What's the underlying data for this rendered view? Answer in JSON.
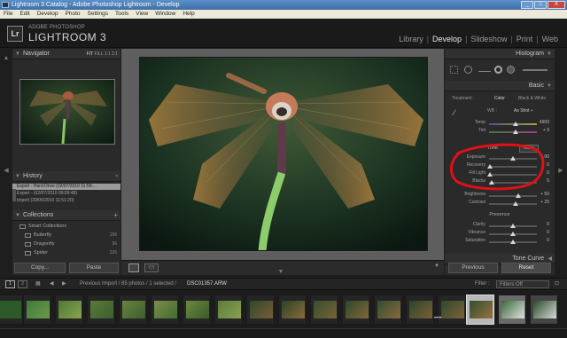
{
  "window": {
    "title": "Lightroom 3 Catalog - Adobe Photoshop Lightroom - Develop",
    "buttons": [
      "_",
      "□",
      "X"
    ]
  },
  "menu": [
    "File",
    "Edit",
    "Develop",
    "Photo",
    "Settings",
    "Tools",
    "View",
    "Window",
    "Help"
  ],
  "identity": {
    "logo": "Lr",
    "product_small": "ADOBE PHOTOSHOP",
    "product_big": "LIGHTROOM 3"
  },
  "modules": [
    {
      "label": "Library",
      "active": false
    },
    {
      "label": "Develop",
      "active": true
    },
    {
      "label": "Slideshow",
      "active": false
    },
    {
      "label": "Print",
      "active": false
    },
    {
      "label": "Web",
      "active": false
    }
  ],
  "navigator": {
    "title": "Navigator",
    "zoom_options": [
      "FIT",
      "FILL",
      "1:1",
      "3:1"
    ]
  },
  "history": {
    "title": "History",
    "items": [
      {
        "label": "Export - Hard Drive (02/07/2010 11:59:...",
        "selected": true
      },
      {
        "label": "Export - (02/07/2010 09:09:48)",
        "selected": false
      },
      {
        "label": "Import (29/06/2010 11:51:20)",
        "selected": false
      }
    ]
  },
  "collections": {
    "title": "Collections",
    "add": "+",
    "group": "Smart Collections",
    "items": [
      {
        "label": "Butterfly",
        "count": "196"
      },
      {
        "label": "Dragonfly",
        "count": "56"
      },
      {
        "label": "Spider",
        "count": "226"
      }
    ]
  },
  "left_buttons": {
    "copy": "Copy...",
    "paste": "Paste"
  },
  "histogram": {
    "title": "Histogram"
  },
  "basic": {
    "title": "Basic",
    "treatment_label": "Treatment :",
    "treatment_color": "Color",
    "treatment_bw": "Black & White",
    "wb_label": "WB :",
    "wb_value": "As Shot ÷",
    "temp": {
      "label": "Temp",
      "value": "4900",
      "pos": 0.55
    },
    "tint": {
      "label": "Tint",
      "value": "+ 9",
      "pos": 0.55
    },
    "tone_label": "Tone",
    "auto": "Auto",
    "exposure": {
      "label": "Exposure",
      "value": "0.00",
      "pos": 0.5
    },
    "recovery": {
      "label": "Recovery",
      "value": "0",
      "pos": 0.02
    },
    "fill_light": {
      "label": "Fill Light",
      "value": "0",
      "pos": 0.02
    },
    "blacks": {
      "label": "Blacks",
      "value": "5",
      "pos": 0.05
    },
    "brightness": {
      "label": "Brightness",
      "value": "+ 50",
      "pos": 0.62
    },
    "contrast": {
      "label": "Contrast",
      "value": "+ 25",
      "pos": 0.56
    },
    "presence_label": "Presence",
    "clarity": {
      "label": "Clarity",
      "value": "0",
      "pos": 0.5
    },
    "vibrance": {
      "label": "Vibrance",
      "value": "0",
      "pos": 0.5
    },
    "saturation": {
      "label": "Saturation",
      "value": "0",
      "pos": 0.5
    }
  },
  "tone_curve": {
    "title": "Tone Curve"
  },
  "right_buttons": {
    "previous": "Previous",
    "reset": "Reset"
  },
  "filmstrip_bar": {
    "pages": [
      "1",
      "2"
    ],
    "path": "Previous Import / 85 photos / 1 selected /",
    "filename": "DSC01357.ARW",
    "filter_label": "Filter :",
    "filter_value": "Filters Off"
  },
  "colors": {
    "annotation": "#e0101a",
    "selected_history": "#9a9a9a"
  }
}
